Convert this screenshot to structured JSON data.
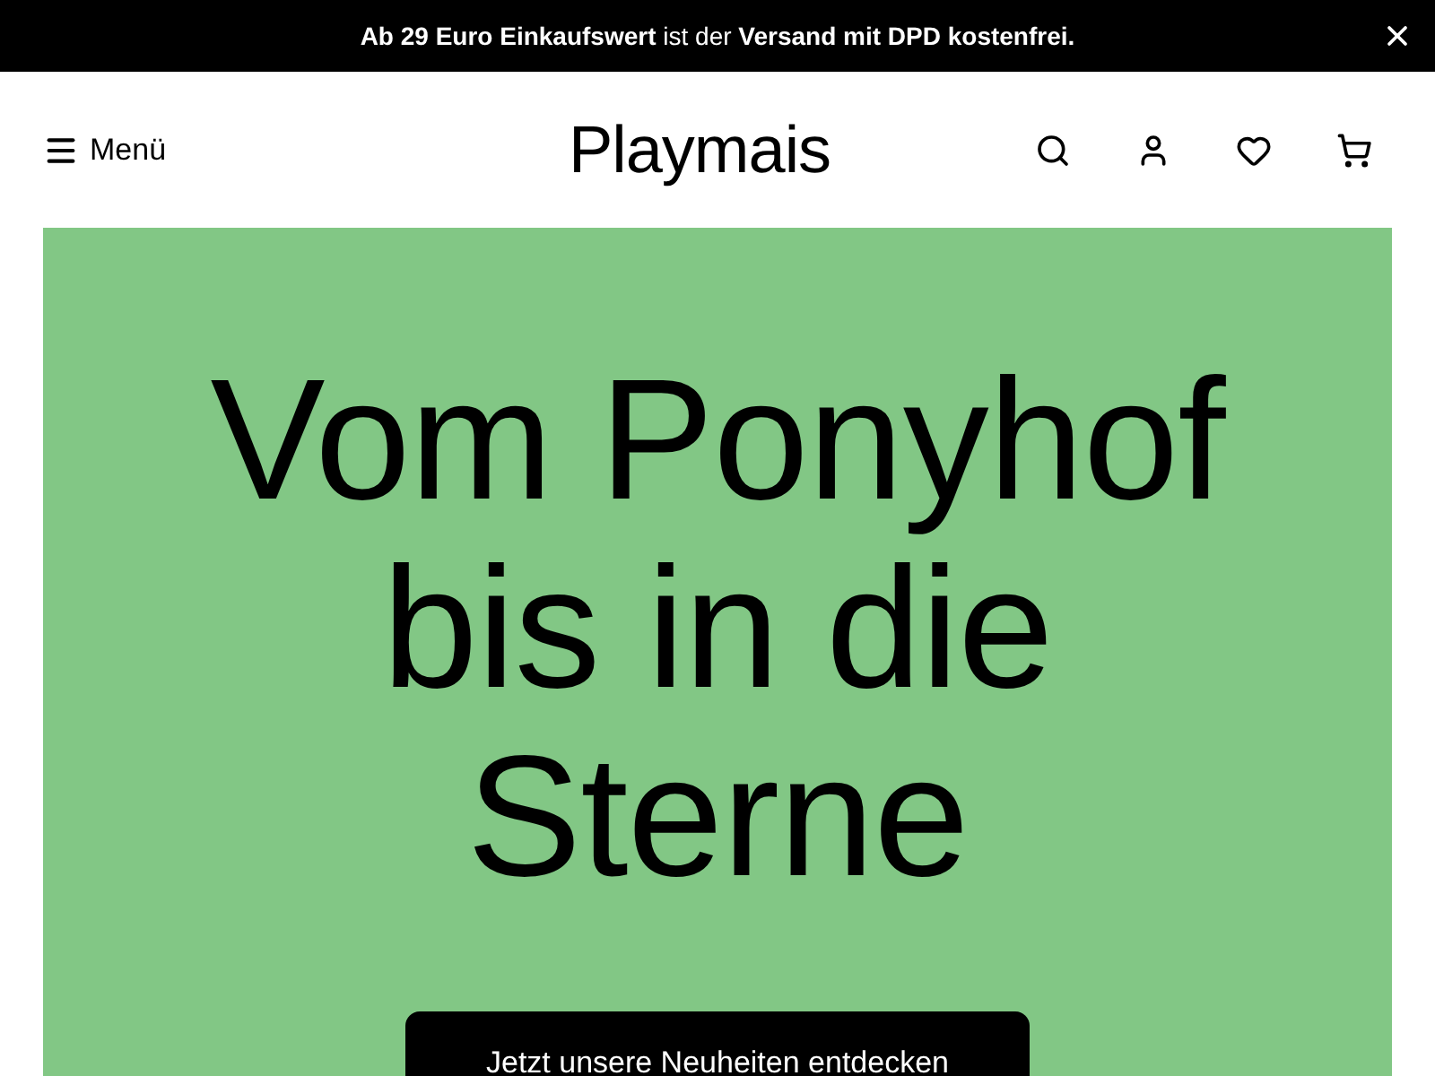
{
  "announcement": {
    "text": "**Ab 29 Euro Einkaufswert** ist der **Versand mit DPD kostenfrei.**"
  },
  "header": {
    "menu_label": "Menü",
    "logo": "Playmais"
  },
  "hero": {
    "headline": "Vom Ponyhof bis in die Sterne",
    "button": "Jetzt unsere Neuheiten entdecken"
  }
}
